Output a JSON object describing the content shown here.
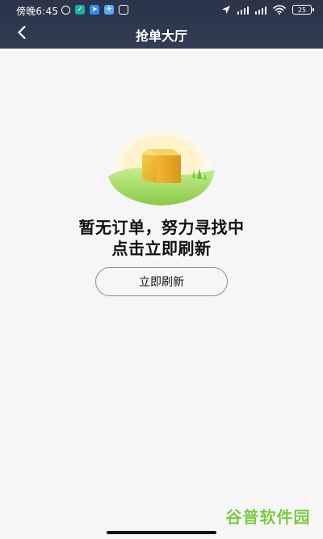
{
  "status_bar": {
    "time": "傍晚6:45",
    "left_icons": [
      "alarm-icon",
      "app-icon-green",
      "app-icon-blue",
      "app-icon-lightblue",
      "app-icon-outline"
    ],
    "right_icons": [
      "location-arrow-icon",
      "hd-signal-icon",
      "hd-signal-icon",
      "wifi-icon",
      "battery-icon"
    ],
    "battery_level": "25"
  },
  "nav": {
    "back_icon": "chevron-left-icon",
    "title": "抢单大厅"
  },
  "empty_state": {
    "illustration": "empty-box-illustration",
    "line1": "暂无订单，努力寻找中",
    "line2": "点击立即刷新",
    "button_label": "立即刷新"
  },
  "watermark": {
    "text": "谷普软件园"
  },
  "colors": {
    "top_bar": "#2e384e",
    "background": "#f6f6f6",
    "box_yellow": "#f1c33b",
    "grass_green": "#8fcf58",
    "watermark_green": "#7ac943"
  }
}
